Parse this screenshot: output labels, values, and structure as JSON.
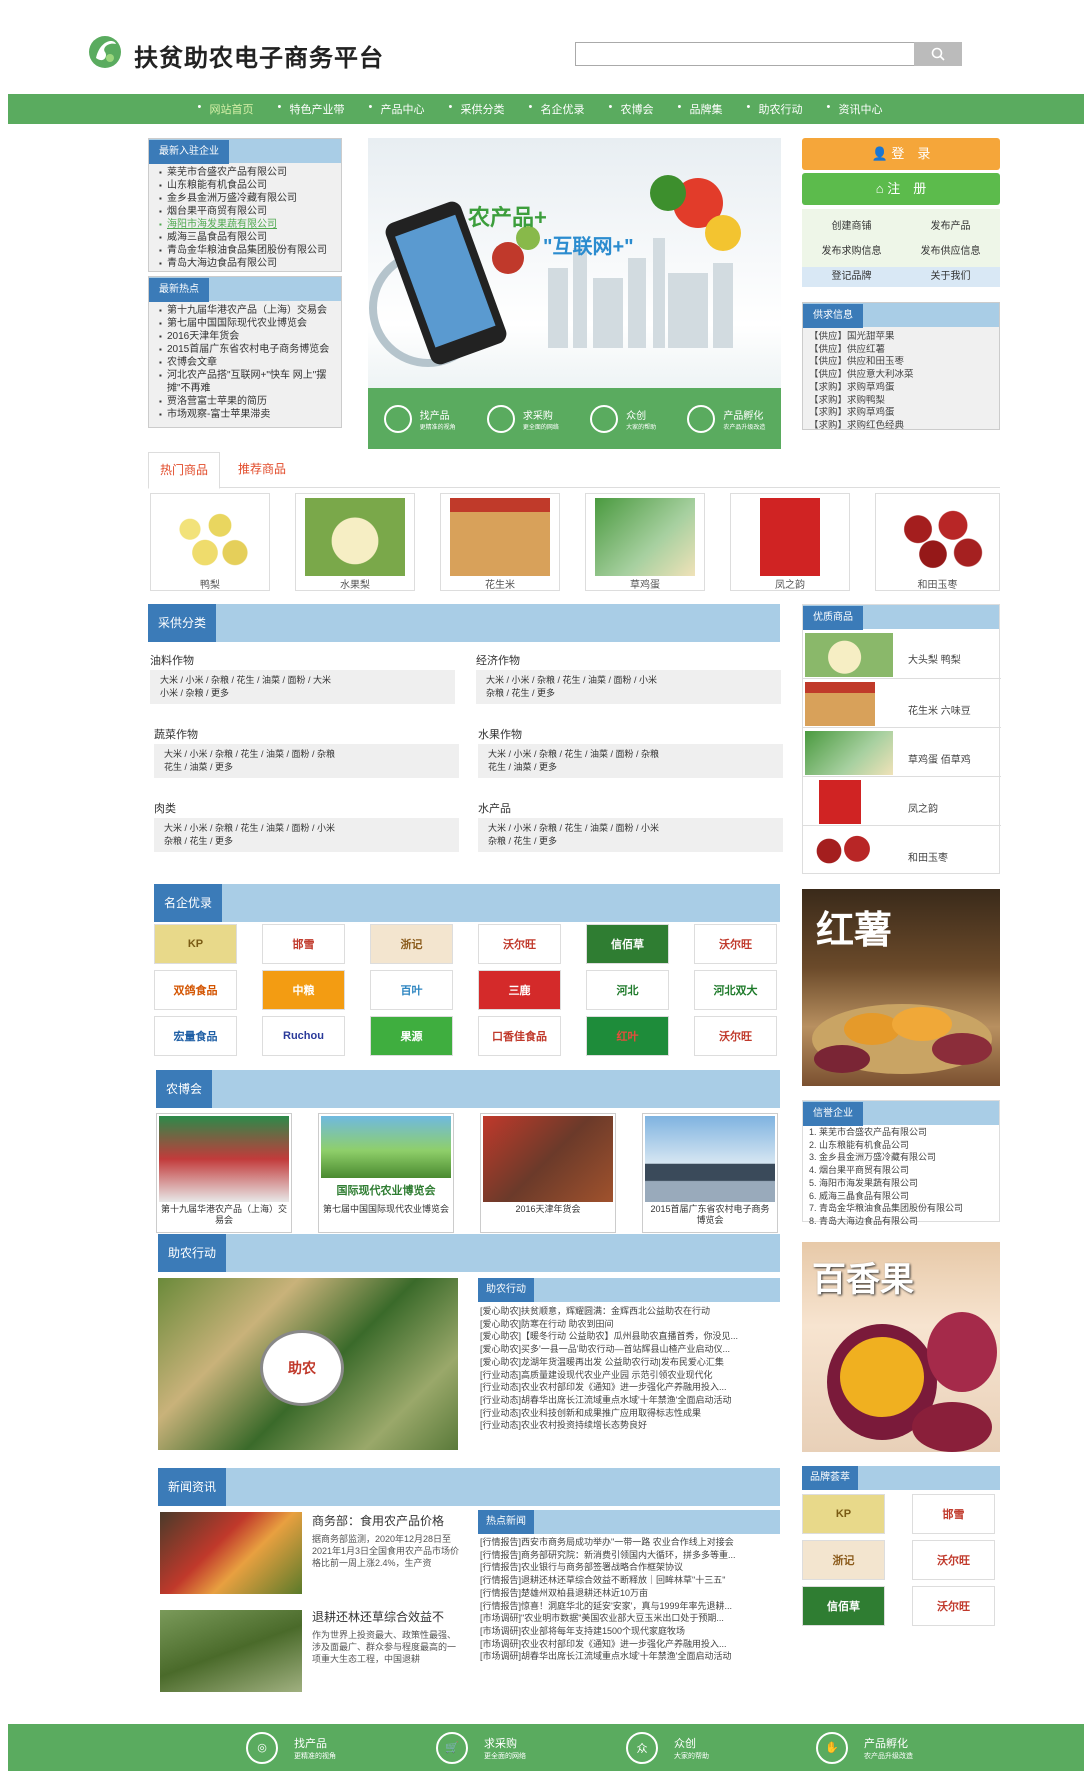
{
  "header": {
    "title": "扶贫助农电子商务平台",
    "search_placeholder": ""
  },
  "nav": [
    "网站首页",
    "特色产业带",
    "产品中心",
    "采供分类",
    "名企优录",
    "农博会",
    "品牌集",
    "助农行动",
    "资讯中心"
  ],
  "new_companies": {
    "title": "最新入驻企业",
    "items": [
      "莱芜市合盛农产品有限公司",
      "山东粮能有机食品公司",
      "金乡县金洲万盛冷藏有限公司",
      "烟台果平商贸有限公司",
      "海阳市海发果蔬有限公司",
      "威海三晶食品有限公司",
      "青岛金华粮油食品集团股份有限公司",
      "青岛大海边食品有限公司"
    ]
  },
  "hot_topics": {
    "title": "最新热点",
    "items": [
      "第十九届华港农产品（上海）交易会",
      "第七届中国国际现代农业博览会",
      "2016天津年货会",
      "2015首届广东省农村电子商务博览会",
      "农博会文章",
      "河北农产品搭\"互联网+\"快车 网上\"摆摊\"不再难",
      "贾洛营富士苹果的简历",
      "市场观察-富士苹果滞卖"
    ]
  },
  "banner": {
    "line1": "农产品+",
    "line2": "\"互联网+\"",
    "items": [
      {
        "t1": "找产品",
        "t2": "更精准的视角"
      },
      {
        "t1": "求采购",
        "t2": "更全面的网络"
      },
      {
        "t1": "众创",
        "t2": "大家的帮助"
      },
      {
        "t1": "产品孵化",
        "t2": "农产品升级改造"
      }
    ]
  },
  "auth": {
    "login": "登　录",
    "register": "注　册"
  },
  "quick_links": [
    "创建商铺",
    "发布产品",
    "发布求购信息",
    "发布供应信息",
    "登记品牌",
    "关于我们"
  ],
  "supply": {
    "title": "供求信息",
    "items": [
      "【供应】国光甜苹果",
      "【供应】供应红薯",
      "【供应】供应和田玉枣",
      "【供应】供应意大利冰菜",
      "【求购】求购草鸡蛋",
      "【求购】求购鸭梨",
      "【求购】求购草鸡蛋",
      "【求购】求购红色经典"
    ]
  },
  "tabs": [
    "热门商品",
    "推荐商品"
  ],
  "hot_products": [
    "鸭梨",
    "水果梨",
    "花生米",
    "草鸡蛋",
    "凤之韵",
    "和田玉枣"
  ],
  "colors": {
    "green": "#5aab5f",
    "blue": "#3b7bb8",
    "lightblue": "#a9cde6",
    "orange": "#f5a63a"
  },
  "purchase": {
    "title": "采供分类",
    "cats": [
      {
        "name": "油料作物",
        "l1": "大米 / 小米 / 杂粮 / 花生 / 油菜 / 面粉 / 大米",
        "l2": "小米 / 杂粮 / 更多"
      },
      {
        "name": "经济作物",
        "l1": "大米 / 小米 / 杂粮 / 花生 / 油菜 / 面粉 / 小米",
        "l2": "杂粮 / 花生 / 更多"
      },
      {
        "name": "蔬菜作物",
        "l1": "大米 / 小米 / 杂粮 / 花生 / 油菜 / 面粉 / 杂粮",
        "l2": "花生 / 油菜 / 更多"
      },
      {
        "name": "水果作物",
        "l1": "大米 / 小米 / 杂粮 / 花生 / 油菜 / 面粉 / 杂粮",
        "l2": "花生 / 油菜 / 更多"
      },
      {
        "name": "肉类",
        "l1": "大米 / 小米 / 杂粮 / 花生 / 油菜 / 面粉 / 小米",
        "l2": "杂粮 / 花生 / 更多"
      },
      {
        "name": "水产品",
        "l1": "大米 / 小米 / 杂粮 / 花生 / 油菜 / 面粉 / 小米",
        "l2": "杂粮 / 花生 / 更多"
      }
    ]
  },
  "quality": {
    "title": "优质商品",
    "items": [
      "大头梨 鸭梨",
      "花生米 六味豆",
      "草鸡蛋 佰草鸡",
      "凤之韵",
      "和田玉枣"
    ]
  },
  "famous": {
    "title": "名企优录",
    "brands": [
      "KP",
      "邯雪",
      "浙记",
      "沃尔旺",
      "信佰草",
      "沃尔旺",
      "双鸽食品",
      "中粮",
      "百叶",
      "三鹿",
      "河北",
      "河北双大",
      "宏量食品",
      "Ruchou",
      "果源",
      "口香佳食品",
      "红叶",
      "沃尔旺"
    ]
  },
  "ad_sweetpotato": "红薯",
  "expo": {
    "title": "农博会",
    "items": [
      "第十九届华港农产品（上海）交易会",
      "第七届中国国际现代农业博览会",
      "2016天津年货会",
      "2015首届广东省农村电子商务博览会"
    ],
    "img2_text": "国际现代农业博览会"
  },
  "credit": {
    "title": "信誉企业",
    "items": [
      "1. 莱芜市合盛农产品有限公司",
      "2. 山东粮能有机食品公司",
      "3. 金乡县金洲万盛冷藏有限公司",
      "4. 烟台果平商贸有限公司",
      "5. 海阳市海发果蔬有限公司",
      "6. 威海三晶食品有限公司",
      "7. 青岛金华粮油食品集团股份有限公司",
      "8. 青岛大海边食品有限公司"
    ]
  },
  "help": {
    "title": "助农行动",
    "sub": "助农行动",
    "badge": "助农",
    "items": [
      "[爱心助农]扶贫顺意，辉耀圆满：金辉西北公益助农在行动",
      "[爱心助农]防寒在行动 助农到田间",
      "[爱心助农]【暖冬行动 公益助农】瓜州县助农直播首秀，你没见...",
      "[爱心助农]买多'一县一品'助农行动—首站辉县山楂产业启动仪...",
      "[爱心助农]龙湖年货温暖再出发 公益助农行动|发布民爱心汇集",
      "[行业动态]高质量建设现代农业产业园 示范引领农业现代化",
      "[行业动态]农业农村部印发《通知》进一步强化产养融用投入...",
      "[行业动态]胡春华出席长江流域重点水域'十年禁渔'全面启动活动",
      "[行业动态]农业科技创新和成果推广应用取得标志性成果",
      "[行业动态]农业农村投资持续增长态势良好"
    ]
  },
  "ad_passion": "百香果",
  "news": {
    "title": "新闻资讯",
    "a1_title": "商务部：食用农产品价格",
    "a1_body": "据商务部监测，2020年12月28日至2021年1月3日全国食用农产品市场价格比前一周上涨2.4%，生产资",
    "a2_title": "退耕还林还草综合效益不",
    "a2_body": "作为世界上投资最大、政策性最强、涉及面最广、群众参与程度最高的一项重大生态工程，中国退耕",
    "hot_title": "热点新闻",
    "hot": [
      "[行情报告]西安市商务局成功举办\"一带一路 农业合作线上对接会",
      "[行情报告]商务部研究院：新消费引领国内大循环，拼多多等重...",
      "[行情报告]农业银行与商务部签署战略合作框架协议",
      "[行情报告]退耕还林还草综合效益不断释放｜回眸林草\"十三五\"",
      "[行情报告]楚雄州双柏县退耕还林近10万亩",
      "[行情报告]惊喜！洞庭华北的延安'安家'，真与1999年率先退耕...",
      "[市场调研]\"农业明市数据\"美国农业部大豆玉米出口处于预期...",
      "[市场调研]农业部将每年支持建1500个现代家庭牧场",
      "[市场调研]农业农村部印发《通知》进一步强化产养融用投入...",
      "[市场调研]胡春华出席长江流域重点水域'十年禁渔'全面启动活动"
    ]
  },
  "brandset": {
    "title": "品牌荟萃",
    "items": [
      "KP",
      "邯雪",
      "浙记",
      "沃尔旺",
      "信佰草",
      "沃尔旺"
    ]
  },
  "footer": [
    {
      "t1": "找产品",
      "t2": "更精准的视角"
    },
    {
      "t1": "求采购",
      "t2": "更全面的网络"
    },
    {
      "t1": "众创",
      "t2": "大家的帮助"
    },
    {
      "t1": "产品孵化",
      "t2": "农产品升级改造"
    }
  ]
}
